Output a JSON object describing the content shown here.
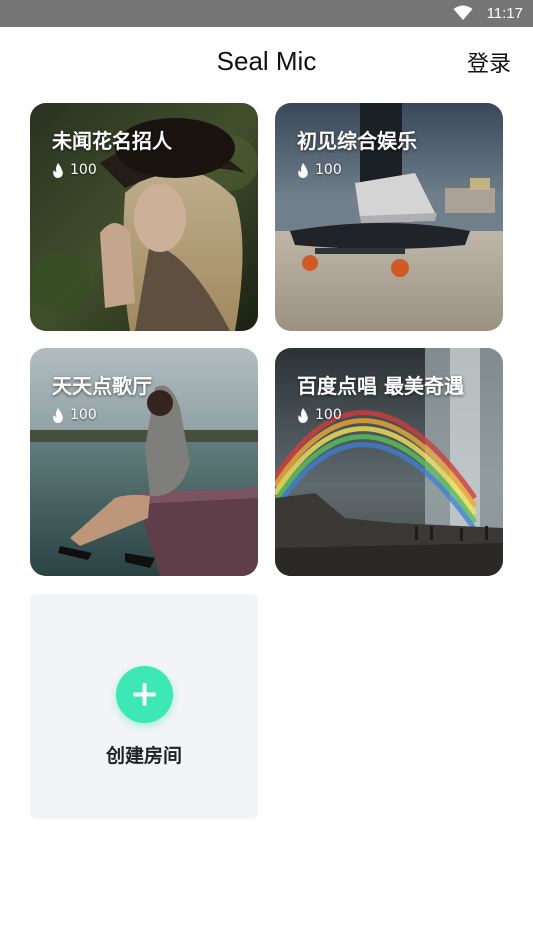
{
  "status_bar": {
    "time": "11:17",
    "wifi_icon": "wifi-icon"
  },
  "app_bar": {
    "title": "Seal Mic",
    "login_label": "登录"
  },
  "rooms": [
    {
      "name": "未闻花名招人",
      "heat": "100"
    },
    {
      "name": "初见综合娱乐",
      "heat": "100"
    },
    {
      "name": "天天点歌厅",
      "heat": "100"
    },
    {
      "name": "百度点唱 最美奇遇",
      "heat": "100"
    }
  ],
  "create_room": {
    "label": "创建房间",
    "icon": "plus-icon"
  },
  "colors": {
    "accent": "#3ee8b4",
    "status_bar": "#757575",
    "create_card_bg": "#f3f4f6"
  }
}
